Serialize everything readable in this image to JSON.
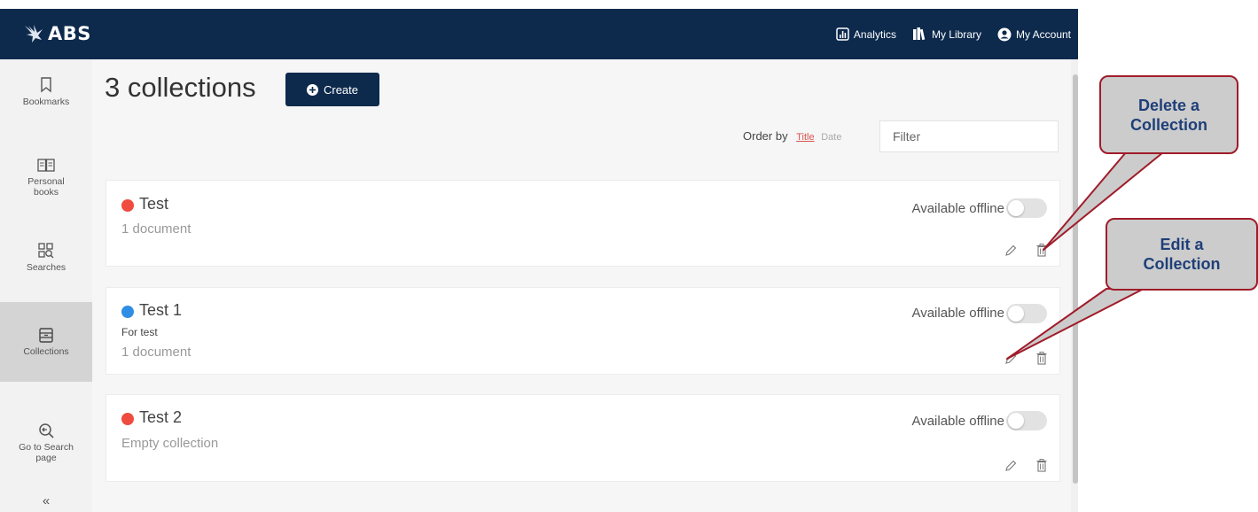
{
  "app": {
    "logo_text": "ABS"
  },
  "nav": {
    "analytics": "Analytics",
    "my_library": "My Library",
    "my_account": "My Account"
  },
  "sidebar": {
    "items": [
      {
        "label": "Bookmarks",
        "icon": "bookmark-icon"
      },
      {
        "label": "Personal books",
        "icon": "book-icon"
      },
      {
        "label": "Searches",
        "icon": "search-grid-icon"
      },
      {
        "label": "Collections",
        "icon": "archive-box-icon",
        "active": true
      },
      {
        "label": "Go to Search page",
        "icon": "search-back-icon"
      }
    ],
    "collapse": "«"
  },
  "main": {
    "title": "3 collections",
    "create_label": "Create",
    "order_by_label": "Order by",
    "order_title": "Title",
    "order_date": "Date",
    "filter_placeholder": "Filter",
    "collections": [
      {
        "name": "Test",
        "color": "#ef4b3f",
        "description": "",
        "documents": "1 document",
        "offline_label": "Available offline",
        "offline": false
      },
      {
        "name": "Test 1",
        "color": "#2f8de4",
        "description": "For test",
        "documents": "1 document",
        "offline_label": "Available offline",
        "offline": false
      },
      {
        "name": "Test 2",
        "color": "#ef4b3f",
        "description": "",
        "documents": "Empty collection",
        "offline_label": "Available offline",
        "offline": false
      }
    ]
  },
  "callouts": {
    "delete": "Delete a Collection",
    "edit": "Edit a Collection"
  },
  "colors": {
    "topbar": "#0d2a4d",
    "accent_red": "#d9534f",
    "callout_border": "#a01c2a",
    "callout_text": "#1f3f78"
  }
}
